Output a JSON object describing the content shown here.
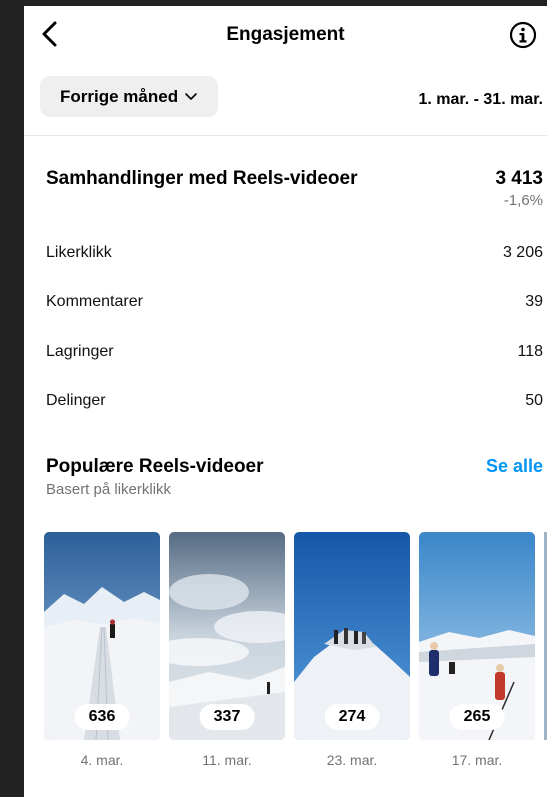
{
  "header": {
    "title": "Engasjement",
    "back_icon": "chevron-left-icon",
    "info_icon": "info-circle-icon"
  },
  "filter": {
    "period_label": "Forrige måned",
    "date_range": "1. mar. - 31. mar."
  },
  "summary": {
    "label": "Samhandlinger med Reels-videoer",
    "total": "3 413",
    "change": "-1,6%"
  },
  "metrics": [
    {
      "label": "Likerklikk",
      "value": "3 206"
    },
    {
      "label": "Kommentarer",
      "value": "39"
    },
    {
      "label": "Lagringer",
      "value": "118"
    },
    {
      "label": "Delinger",
      "value": "50"
    }
  ],
  "popular": {
    "title": "Populære Reels-videoer",
    "subtitle": "Basert på likerklikk",
    "see_all": "Se alle",
    "reels": [
      {
        "count": "636",
        "date": "4. mar."
      },
      {
        "count": "337",
        "date": "11. mar."
      },
      {
        "count": "274",
        "date": "23. mar."
      },
      {
        "count": "265",
        "date": "17. mar."
      }
    ]
  },
  "colors": {
    "link": "#0095f6",
    "muted": "#737373",
    "pill_bg": "#efefef"
  }
}
